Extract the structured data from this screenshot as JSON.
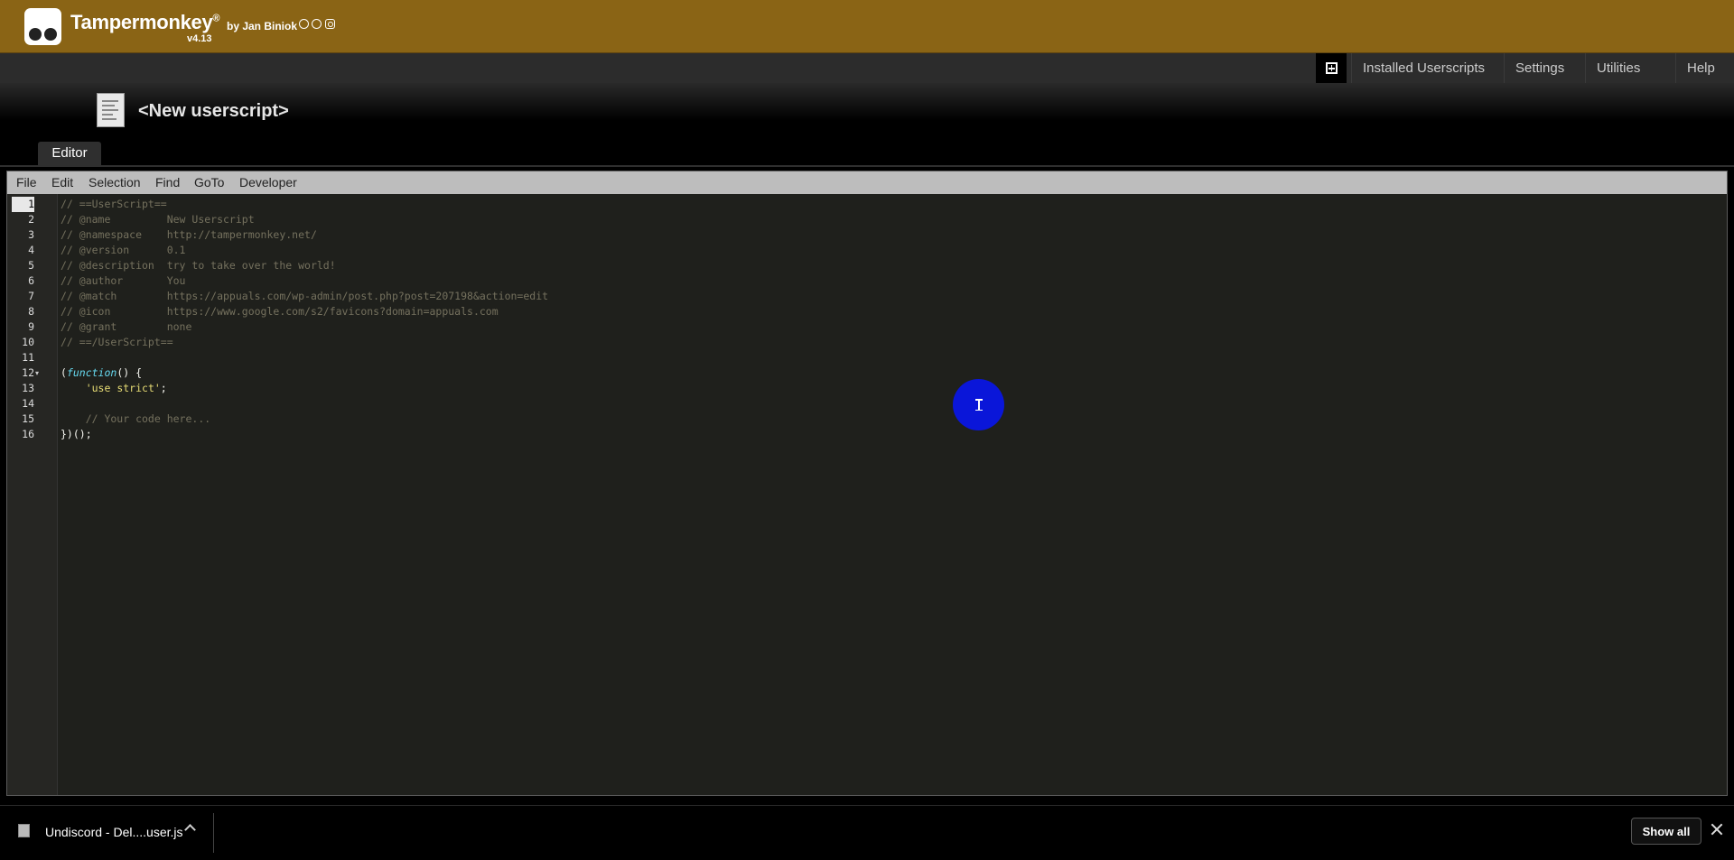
{
  "header": {
    "app_name": "Tampermonkey",
    "registered_mark": "®",
    "version": "v4.13",
    "byline": "by Jan Biniok",
    "social_icons": [
      "github-icon",
      "facebook-icon",
      "instagram-icon"
    ]
  },
  "nav": {
    "new_script_icon": "plus-box-icon",
    "tabs": [
      "Installed Userscripts",
      "Settings",
      "Utilities",
      "Help"
    ]
  },
  "script": {
    "title": "<New userscript>",
    "editor_tab": "Editor"
  },
  "editor": {
    "menu": [
      "File",
      "Edit",
      "Selection",
      "Find",
      "GoTo",
      "Developer"
    ],
    "line_numbers": [
      "1",
      "2",
      "3",
      "4",
      "5",
      "6",
      "7",
      "8",
      "9",
      "10",
      "11",
      "12",
      "13",
      "14",
      "15",
      "16"
    ],
    "active_line": "1",
    "fold_marker_line": "12"
  },
  "code": {
    "l1": "// ==UserScript==",
    "l2": "// @name         New Userscript",
    "l3": "// @namespace    http://tampermonkey.net/",
    "l4": "// @version      0.1",
    "l5": "// @description  try to take over the world!",
    "l6": "// @author       You",
    "l7": "// @match        https://appuals.com/wp-admin/post.php?post=207198&action=edit",
    "l8": "// @icon         https://www.google.com/s2/favicons?domain=appuals.com",
    "l9": "// @grant        none",
    "l10": "// ==/UserScript==",
    "l12_open": "(",
    "l12_kw": "function",
    "l12_rest": "() {",
    "l13_indent": "    ",
    "l13_str": "'use strict'",
    "l13_end": ";",
    "l15": "    // Your code here...",
    "l16": "})();"
  },
  "download_bar": {
    "file_name": "Undiscord - Del....user.js",
    "show_all": "Show all"
  },
  "colors": {
    "header_bg": "#8a6415",
    "editor_bg": "#1f201c",
    "comment": "#75715e",
    "keyword": "#66d9ef",
    "string": "#e6db74",
    "cursor_highlight": "#0a16d9"
  }
}
